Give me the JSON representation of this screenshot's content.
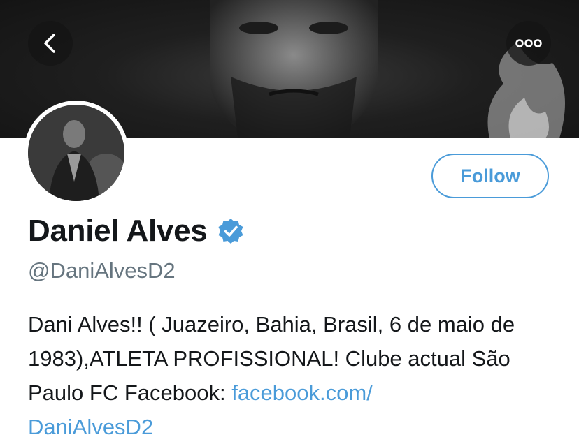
{
  "header": {
    "back_icon": "chevron-left-icon",
    "more_icon": "more-dots-icon"
  },
  "profile": {
    "name": "Daniel Alves",
    "verified_icon": "verified-badge-icon",
    "handle": "@DaniAlvesD2",
    "follow_label": "Follow",
    "bio_text": "Dani Alves!! ( Juazeiro, Bahia, Brasil, 6 de maio de 1983),ATLETA PROFISSIONAL! Clube actual São Paulo FC Facebook: ",
    "bio_link_line1": "facebook.com/",
    "bio_link_line2": "DaniAlvesD2"
  },
  "colors": {
    "accent": "#4a9bd9",
    "text": "#14171a",
    "secondary": "#66757f"
  }
}
